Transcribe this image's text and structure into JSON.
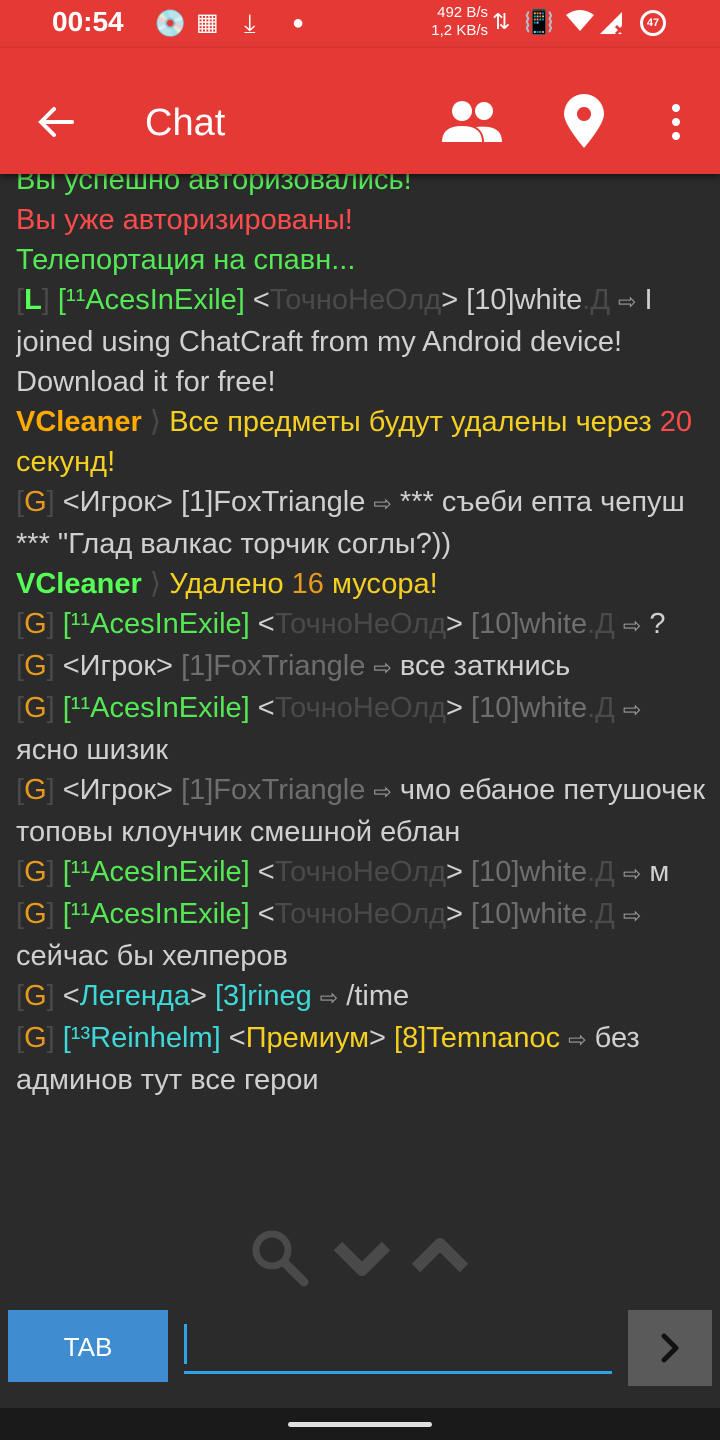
{
  "status": {
    "time": "00:54",
    "net_up": "492 B/s",
    "net_down": "1,2 KB/s",
    "battery": "47",
    "icons": [
      "cd-icon",
      "grid-icon",
      "download-icon",
      "dot-icon",
      "data-arrows-icon",
      "vibrate-icon",
      "wifi-icon",
      "signal-icon",
      "battery-icon"
    ]
  },
  "app_bar": {
    "title": "Chat"
  },
  "chat": {
    "m0": "Вы успешно авторизовались!",
    "m1": "Вы уже авторизированы!",
    "m2": "Телепортация на спавн...",
    "m3": {
      "br_open": "[",
      "ch": "L",
      "br_close": "]",
      "rank": "[¹¹AcesInExile]",
      "lt": "<",
      "prefix": "ТочноНеОлд",
      "gt": ">",
      "lvl": "[10]white",
      "suffix": ".Д",
      "arrow": "⇨",
      "text": "I joined using ChatCraft from my Android device! Download it for free!"
    },
    "m4": {
      "sender": "VCleaner",
      "sep": "⟩",
      "text1": "Все предметы будут удалены через",
      "num": "20",
      "text2": "секунд!"
    },
    "m5": {
      "br_open": "[",
      "ch": "G",
      "br_close": "]",
      "role": "<Игрок>",
      "name": "[1]FoxTriangle",
      "arrow": "⇨",
      "text": "*** съеби епта чепуш *** \"Глад валкас торчик соглы?))"
    },
    "m6": {
      "sender": "VCleaner",
      "sep": "⟩",
      "text1": "Удалено",
      "num": "16",
      "text2": "мусора!"
    },
    "m7": {
      "br_open": "[",
      "ch": "G",
      "br_close": "]",
      "rank": "[¹¹AcesInExile]",
      "lt": "<",
      "prefix": "ТочноНеОлд",
      "gt": ">",
      "lvl": "[10]white",
      "suffix": ".Д",
      "arrow": "⇨",
      "text": "?"
    },
    "m8": {
      "br_open": "[",
      "ch": "G",
      "br_close": "]",
      "role": "<Игрок>",
      "name": "[1]FoxTriangle",
      "arrow": "⇨",
      "text": "все заткнись"
    },
    "m9": {
      "br_open": "[",
      "ch": "G",
      "br_close": "]",
      "rank": "[¹¹AcesInExile]",
      "lt": "<",
      "prefix": "ТочноНеОлд",
      "gt": ">",
      "lvl": "[10]white",
      "suffix": ".Д",
      "arrow": "⇨",
      "text": "ясно шизик"
    },
    "m10": {
      "br_open": "[",
      "ch": "G",
      "br_close": "]",
      "role": "<Игрок>",
      "name": "[1]FoxTriangle",
      "arrow": "⇨",
      "text": "чмо ебаное петушочек топовы клоунчик смешной еблан"
    },
    "m11": {
      "br_open": "[",
      "ch": "G",
      "br_close": "]",
      "rank": "[¹¹AcesInExile]",
      "lt": "<",
      "prefix": "ТочноНеОлд",
      "gt": ">",
      "lvl": "[10]white",
      "suffix": ".Д",
      "arrow": "⇨",
      "text": "м"
    },
    "m12": {
      "br_open": "[",
      "ch": "G",
      "br_close": "]",
      "rank": "[¹¹AcesInExile]",
      "lt": "<",
      "prefix": "ТочноНеОлд",
      "gt": ">",
      "lvl": "[10]white",
      "suffix": ".Д",
      "arrow": "⇨",
      "text": "сейчас бы хелперов"
    },
    "m13": {
      "br_open": "[",
      "ch": "G",
      "br_close": "]",
      "lt": "<",
      "role": "Легенда",
      "gt": ">",
      "name": "[3]rineg",
      "arrow": "⇨",
      "text": "/time"
    },
    "m14": {
      "br_open": "[",
      "ch": "G",
      "br_close": "]",
      "rank": "[¹³Reinhelm]",
      "lt": "<",
      "role": "Премиум",
      "gt": ">",
      "name": "[8]Temnanoc",
      "arrow": "⇨",
      "text": "без админов тут все герои"
    }
  },
  "controls": {
    "tab_label": "TAB",
    "input_value": ""
  },
  "colors": {
    "accent": "#e53935",
    "tab": "#3f8cd0",
    "input_underline": "#2fa3e6"
  }
}
